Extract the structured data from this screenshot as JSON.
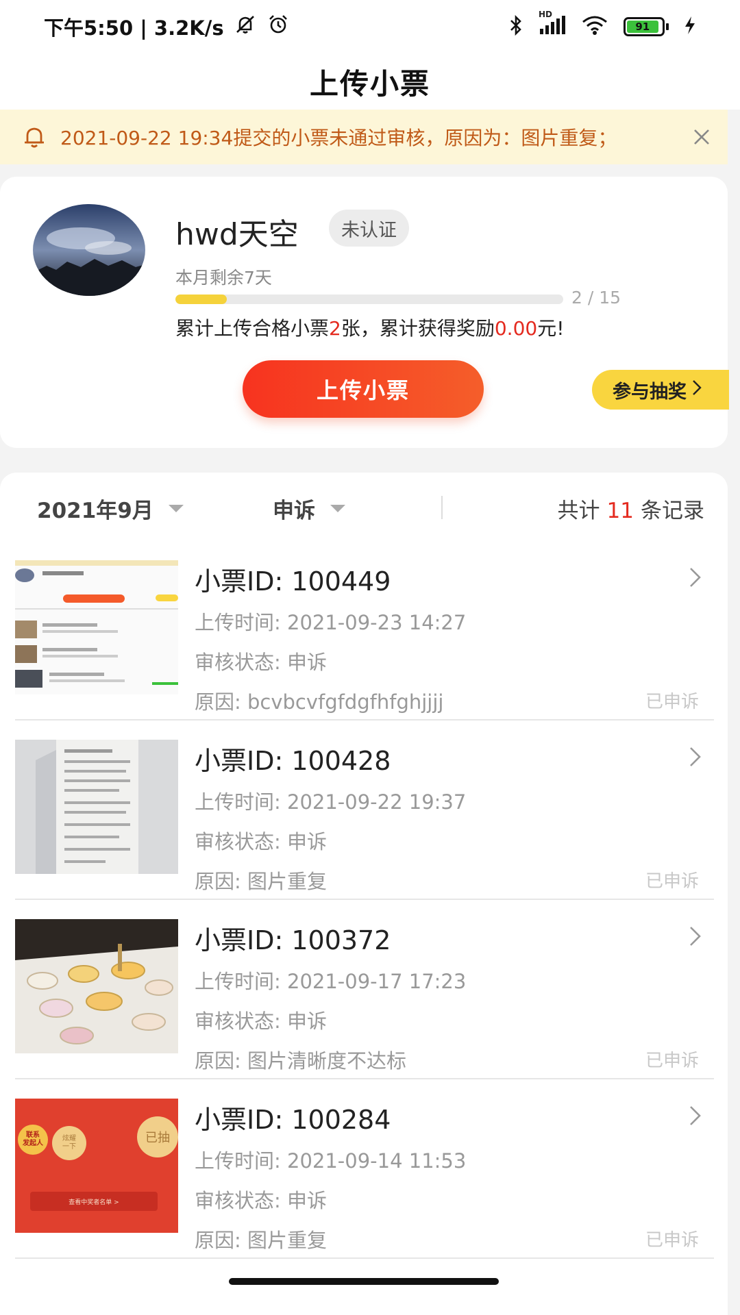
{
  "status_bar": {
    "time_speed": "下午5:50 | 3.2K/s",
    "hd": "HD",
    "battery": "91",
    "icons": [
      "silent-icon",
      "alarm-icon",
      "bluetooth-icon",
      "signal-icon",
      "wifi-icon",
      "battery-icon",
      "charging-icon"
    ]
  },
  "title": "上传小票",
  "notice": {
    "text": "2021-09-22 19:34提交的小票未通过审核，原因为：图片重复；",
    "icon": "bell-icon",
    "close_icon": "close-icon"
  },
  "user": {
    "name": "hwd天空",
    "badge": "未认证",
    "remaining": "本月剩余7天",
    "progress": {
      "current": 2,
      "total": 15,
      "label": "2 / 15",
      "fraction": 0.133
    },
    "summary_prefix": "累计上传合格小票",
    "summary_count": "2",
    "summary_mid": "张，累计获得奖励",
    "summary_amount": "0.00",
    "summary_suffix": "元!",
    "upload_button": "上传小票",
    "lottery_button": "参与抽奖"
  },
  "filters": {
    "date": "2021年9月",
    "status": "申诉",
    "total_prefix": "共计",
    "total_count": "11",
    "total_suffix": "条记录"
  },
  "records": [
    {
      "id": "小票ID: 100449",
      "upload_time": "上传时间: 2021-09-23 14:27",
      "status": "审核状态: 申诉",
      "reason": "原因: bcvbcvfgfdgfhfghjjjj",
      "tag": "已申诉"
    },
    {
      "id": "小票ID: 100428",
      "upload_time": "上传时间: 2021-09-22 19:37",
      "status": "审核状态: 申诉",
      "reason": "原因: 图片重复",
      "tag": "已申诉"
    },
    {
      "id": "小票ID: 100372",
      "upload_time": "上传时间: 2021-09-17 17:23",
      "status": "审核状态: 申诉",
      "reason": "原因: 图片清晰度不达标",
      "tag": "已申诉"
    },
    {
      "id": "小票ID: 100284",
      "upload_time": "上传时间: 2021-09-14 11:53",
      "status": "审核状态: 申诉",
      "reason": "原因: 图片重复",
      "tag": "已申诉"
    }
  ],
  "thumb4": {
    "left_badge": "联系\n发起人",
    "mid_badge": "炫耀\n一下",
    "right_badge": "已抽",
    "banner": "查看中奖者名单 >"
  },
  "colors": {
    "accent_red": "#e42a1f",
    "notice_bg": "#fdf6d8",
    "notice_text": "#c05a18",
    "lottery_yellow": "#f9d53f",
    "progress_yellow": "#f5d23b"
  }
}
